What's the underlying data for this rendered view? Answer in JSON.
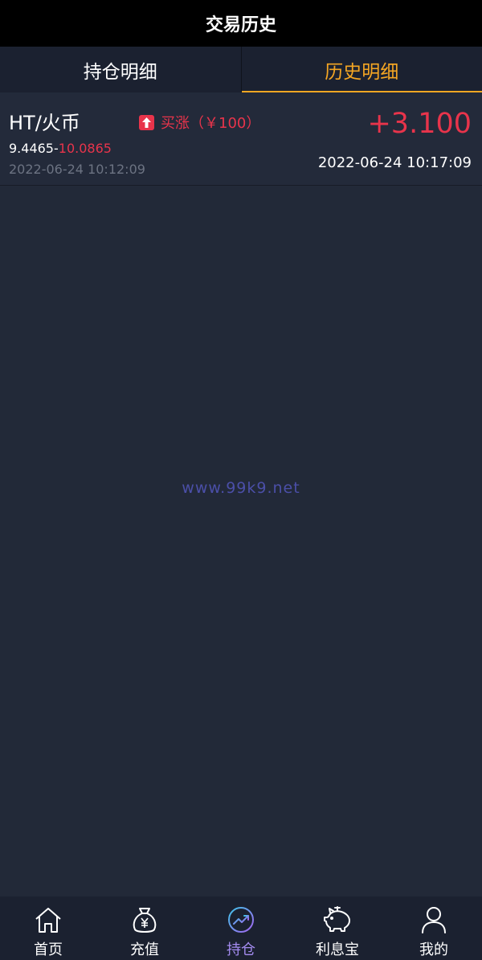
{
  "header": {
    "title": "交易历史"
  },
  "tabs": [
    {
      "label": "持仓明细",
      "active": false
    },
    {
      "label": "历史明细",
      "active": true
    }
  ],
  "records": [
    {
      "pair": "HT/火币",
      "direction": "买涨（￥100）",
      "open_price": "9.4465",
      "separator": "-",
      "close_price": "10.0865",
      "open_time": "2022-06-24 10:12:09",
      "profit": "+3.100",
      "close_time": "2022-06-24 10:17:09"
    }
  ],
  "watermark": "www.99k9.net",
  "bottom_nav": [
    {
      "label": "首页",
      "icon": "home-icon"
    },
    {
      "label": "充值",
      "icon": "money-bag-icon"
    },
    {
      "label": "持仓",
      "icon": "chart-trend-icon",
      "active": true
    },
    {
      "label": "利息宝",
      "icon": "piggy-bank-icon"
    },
    {
      "label": "我的",
      "icon": "user-icon"
    }
  ],
  "colors": {
    "background": "#222938",
    "header": "#000000",
    "accent": "#f5a623",
    "up": "#e8344b",
    "nav_active": "#a48cf0"
  }
}
